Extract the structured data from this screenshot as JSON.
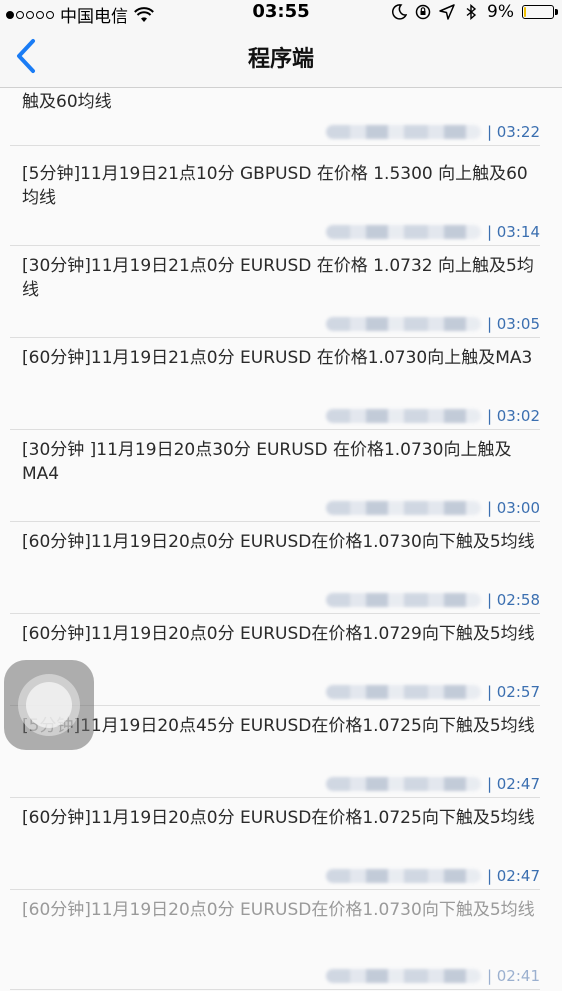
{
  "status_bar": {
    "carrier": "中国电信",
    "time": "03:55",
    "battery": "9%",
    "battery_level": 0.09,
    "icons": [
      "signal-dots-icon",
      "wifi-icon",
      "moon-icon",
      "rotation-lock-icon",
      "location-arrow-icon",
      "bluetooth-icon",
      "battery-icon"
    ]
  },
  "nav": {
    "back_icon": "chevron-left-icon",
    "title": "程序端"
  },
  "messages": [
    {
      "text": "触及60均线",
      "time": "| 03:22"
    },
    {
      "text": "[5分钟]11月19日21点10分 GBPUSD 在价格 1.5300 向上触及60均线",
      "time": "| 03:14"
    },
    {
      "text": "[30分钟]11月19日21点0分 EURUSD 在价格 1.0732 向上触及5均线",
      "time": "| 03:05"
    },
    {
      "text": "[60分钟]11月19日21点0分 EURUSD 在价格1.0730向上触及MA3",
      "time": "| 03:02"
    },
    {
      "text": "[30分钟 ]11月19日20点30分 EURUSD 在价格1.0730向上触及MA4",
      "time": "| 03:00"
    },
    {
      "text": "[60分钟]11月19日20点0分 EURUSD在价格1.0730向下触及5均线",
      "time": "| 02:58"
    },
    {
      "text": "[60分钟]11月19日20点0分 EURUSD在价格1.0729向下触及5均线",
      "time": "| 02:57"
    },
    {
      "text": "[5分钟]11月19日20点45分 EURUSD在价格1.0725向下触及5均线",
      "time": "| 02:47"
    },
    {
      "text": "[60分钟]11月19日20点0分 EURUSD在价格1.0725向下触及5均线",
      "time": "| 02:47"
    },
    {
      "text": "[60分钟]11月19日20点0分 EURUSD在价格1.0730向下触及5均线",
      "time": "| 02:41"
    }
  ]
}
